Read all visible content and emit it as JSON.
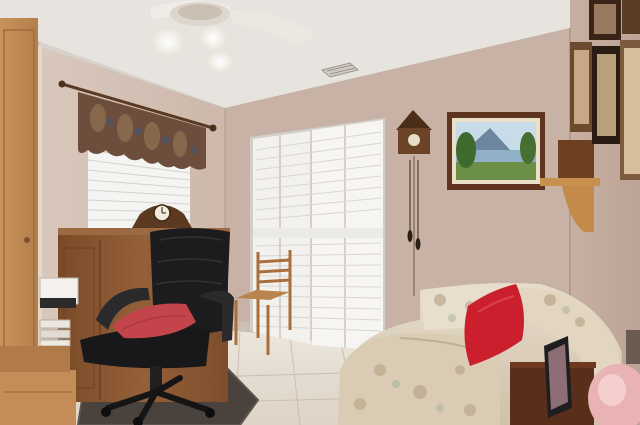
{
  "scene": {
    "colors": {
      "wall": "#c9b3a6",
      "ceiling": "#e9e6e2",
      "floor_tile": "#e6ddd0",
      "wood": "#8a5a33",
      "closet_door": "#f3f2ef",
      "chair_leather": "#1c1c1e",
      "cushion_red": "#c4303c",
      "pillow_red": "#cf1f2e",
      "sofa_fabric": "#dcd0bd"
    },
    "elements": [
      "ceiling-fan",
      "air-vent",
      "window-blinds",
      "valance-curtain",
      "mantel-clock",
      "wooden-cabinet",
      "office-chair",
      "pink-cushion",
      "louvered-closet-doors",
      "cuckoo-clock",
      "landscape-painting",
      "wall-shelf",
      "ladder-back-chair",
      "floral-loveseat",
      "red-pillow",
      "framed-pictures",
      "tiled-floor",
      "area-rug",
      "wooden-door"
    ]
  }
}
